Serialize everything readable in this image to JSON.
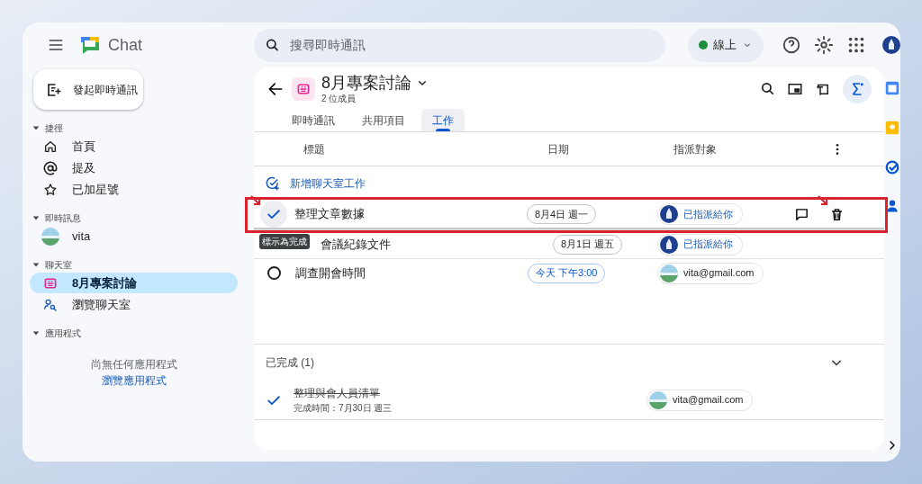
{
  "app": {
    "name": "Chat"
  },
  "search": {
    "placeholder": "搜尋即時通訊"
  },
  "status": {
    "label": "線上",
    "color": "#1e8e3e"
  },
  "sidebar": {
    "new_chat": "發起即時通訊",
    "sections": [
      {
        "title": "捷徑",
        "expanded": true,
        "items": [
          {
            "label": "首頁",
            "selected": false
          },
          {
            "label": "提及",
            "selected": false
          },
          {
            "label": "已加星號",
            "selected": false
          }
        ]
      },
      {
        "title": "即時訊息",
        "expanded": true,
        "items": [
          {
            "label": "vita",
            "selected": false
          }
        ]
      },
      {
        "title": "聊天室",
        "expanded": true,
        "items": [
          {
            "label": "8月專案討論",
            "selected": true
          },
          {
            "label": "瀏覽聊天室",
            "selected": false
          }
        ]
      },
      {
        "title": "應用程式",
        "expanded": true,
        "empty": "尚無任何應用程式",
        "link": "瀏覽應用程式"
      }
    ]
  },
  "room": {
    "title": "8月專案討論",
    "members": "2 位成員",
    "tabs": [
      {
        "label": "即時通訊",
        "selected": false
      },
      {
        "label": "共用項目",
        "selected": false
      },
      {
        "label": "工作",
        "selected": true
      }
    ],
    "columns": [
      "標題",
      "日期",
      "指派對象"
    ],
    "add_task": "新增聊天室工作",
    "tooltip": "標示為完成",
    "tasks": [
      {
        "title": "整理文章數據",
        "date": "8月4日 週一",
        "due_today": false,
        "assignee": "已指派給你",
        "assigned_to_you": true,
        "hovered": true,
        "highlighted": true
      },
      {
        "title": "會議紀錄文件",
        "date": "8月1日 週五",
        "due_today": false,
        "assignee": "已指派給你",
        "assigned_to_you": true,
        "hovered": false,
        "highlighted": false
      },
      {
        "title": "調查開會時間",
        "date": "今天 下午3:00",
        "due_today": true,
        "assignee": "vita@gmail.com",
        "assigned_to_you": false,
        "hovered": false,
        "highlighted": false
      }
    ],
    "completed": {
      "title": "已完成 (1)",
      "expanded": true,
      "tasks": [
        {
          "title": "整理與會人員清單",
          "done_at": "完成時間：7月30日 週三",
          "assignee": "vita@gmail.com",
          "assigned_to_you": false
        }
      ]
    }
  }
}
